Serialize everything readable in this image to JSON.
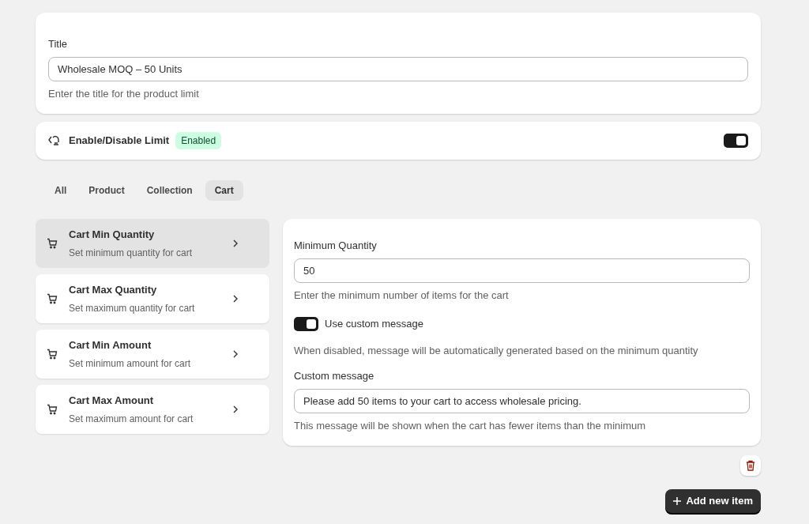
{
  "title_card": {
    "label": "Title",
    "value": "Wholesale MOQ – 50 Units",
    "help": "Enter the title for the product limit"
  },
  "limit": {
    "label": "Enable/Disable Limit",
    "badge": "Enabled",
    "on": true
  },
  "tabs": [
    {
      "label": "All",
      "selected": false
    },
    {
      "label": "Product",
      "selected": false
    },
    {
      "label": "Collection",
      "selected": false
    },
    {
      "label": "Cart",
      "selected": true
    }
  ],
  "rules": [
    {
      "title": "Cart Min Quantity",
      "subtitle": "Set minimum quantity for cart",
      "selected": true
    },
    {
      "title": "Cart Max Quantity",
      "subtitle": "Set maximum quantity for cart",
      "selected": false
    },
    {
      "title": "Cart Min Amount",
      "subtitle": "Set minimum amount for cart",
      "selected": false
    },
    {
      "title": "Cart Max Amount",
      "subtitle": "Set maximum amount for cart",
      "selected": false
    }
  ],
  "detail": {
    "quantity_label": "Minimum Quantity",
    "quantity_value": "50",
    "quantity_help": "Enter the minimum number of items for the cart",
    "custom_toggle_label": "Use custom message",
    "custom_on": true,
    "custom_toggle_help": "When disabled, message will be automatically generated based on the minimum quantity",
    "message_label": "Custom message",
    "message_value": "Please add 50 items to your cart to access wholesale pricing.",
    "message_help": "This message will be shown when the cart has fewer items than the minimum"
  },
  "add_button": "Add new item"
}
